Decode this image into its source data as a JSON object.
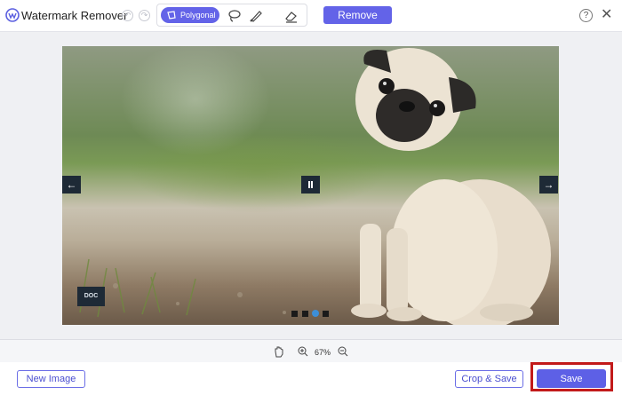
{
  "app": {
    "title": "Watermark Remover"
  },
  "toolbar": {
    "polygon_label": "Polygonal",
    "remove_label": "Remove",
    "help_label": "?",
    "close_label": "✕"
  },
  "canvas": {
    "watermark_text": "DOC",
    "slide_count": 4,
    "active_slide": 3
  },
  "zoom": {
    "value": "67%"
  },
  "footer": {
    "new_image_label": "New Image",
    "crop_save_label": "Crop & Save",
    "save_label": "Save"
  },
  "colors": {
    "accent": "#6363e8",
    "highlight": "#c21a1a",
    "overlay": "#1e2a36"
  }
}
